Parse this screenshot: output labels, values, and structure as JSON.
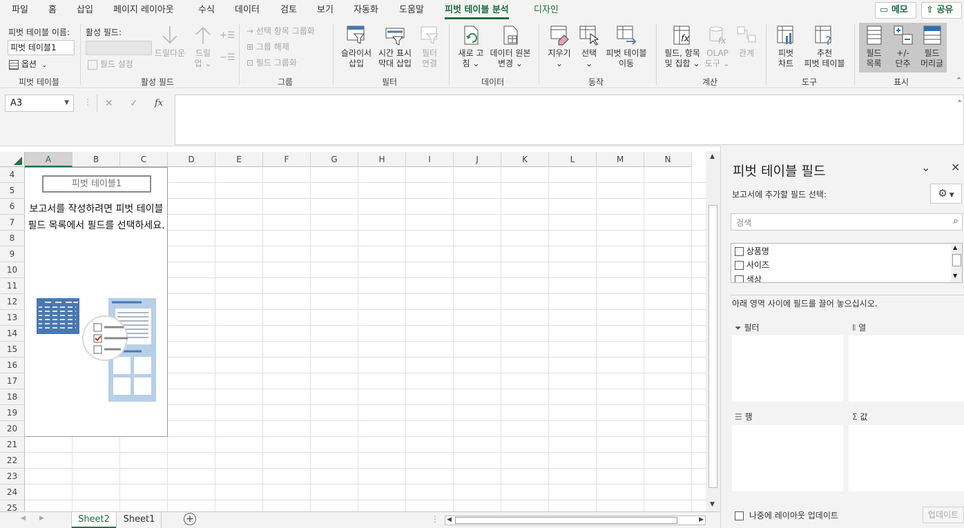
{
  "menu": {
    "tabs": [
      "파일",
      "홈",
      "삽입",
      "페이지 레이아웃",
      "수식",
      "데이터",
      "검토",
      "보기",
      "자동화",
      "도움말",
      "피벗 테이블 분석",
      "디자인"
    ],
    "memo": "메모",
    "share": "공유"
  },
  "ribbon": {
    "pivot_name_label": "피벗 테이블 이름:",
    "pivot_name_value": "피벗 테이블1",
    "options": "옵션",
    "grp_pivot": "피벗 테이블",
    "active_field_label": "활성 필드:",
    "field_settings": "필드 설정",
    "drilldown": "드릴다운",
    "drillup_1": "드릴",
    "drillup_2": "업",
    "grp_active": "활성 필드",
    "group_selection": "선택 항목 그룹화",
    "ungroup": "그룹 해제",
    "group_field": "필드 그룹화",
    "grp_group": "그룹",
    "slicer_1": "슬라이서",
    "slicer_2": "삽입",
    "timeline_1": "시간 표시",
    "timeline_2": "막대 삽입",
    "filterconn_1": "필터",
    "filterconn_2": "연결",
    "grp_filter": "필터",
    "refresh_1": "새로 고",
    "refresh_2": "침",
    "changesrc_1": "데이터 원본",
    "changesrc_2": "변경",
    "grp_data": "데이터",
    "clear": "지우기",
    "select": "선택",
    "move_1": "피벗 테이블",
    "move_2": "이동",
    "grp_actions": "동작",
    "fields_items_1": "필드, 항목",
    "fields_items_2": "및 집합",
    "olap_1": "OLAP",
    "olap_2": "도구",
    "relations": "관계",
    "grp_calc": "계산",
    "pivotchart_1": "피벗",
    "pivotchart_2": "차트",
    "recommended_1": "추천",
    "recommended_2": "피벗 테이블",
    "grp_tools": "도구",
    "fieldlist_1": "필드",
    "fieldlist_2": "목록",
    "plusminus_1": "+/-",
    "plusminus_2": "단추",
    "headers_1": "필드",
    "headers_2": "머리글",
    "grp_show": "표시"
  },
  "formula_bar": {
    "name_box": "A3",
    "cancel": "✕",
    "enter": "✓",
    "fx": "fx",
    "value": ""
  },
  "grid": {
    "columns": [
      "A",
      "B",
      "C",
      "D",
      "E",
      "F",
      "G",
      "H",
      "I",
      "J",
      "K",
      "L",
      "M",
      "N"
    ],
    "rows": [
      "4",
      "5",
      "6",
      "7",
      "8",
      "9",
      "10",
      "11",
      "12",
      "13",
      "14",
      "15",
      "16",
      "17",
      "18",
      "19",
      "20",
      "21",
      "22",
      "23",
      "24",
      "25"
    ],
    "selected_column": "A"
  },
  "pivot_placeholder": {
    "name": "피벗 테이블1",
    "hint": "보고서를 작성하려면 피벗 테이블 필드 목록에서 필드를 선택하세요."
  },
  "sheets": {
    "tabs": [
      "Sheet2",
      "Sheet1"
    ],
    "active": "Sheet2"
  },
  "field_pane": {
    "title": "피벗 테이블 필드",
    "subtitle": "보고서에 추가할 필드 선택:",
    "search_placeholder": "검색",
    "fields": [
      "상품명",
      "사이즈",
      "색상"
    ],
    "drag_hint": "아래 영역 사이에 필드를 끌어 놓으십시오.",
    "zone_filter": "필터",
    "zone_columns": "열",
    "zone_rows": "행",
    "zone_values": "값",
    "defer_update": "나중에 레이아웃 업데이트",
    "update_button": "업데이트"
  },
  "colors": {
    "accent": "#1e6e42",
    "excel_green": "#217346",
    "pivot_icon_blue": "#4a78b0"
  }
}
